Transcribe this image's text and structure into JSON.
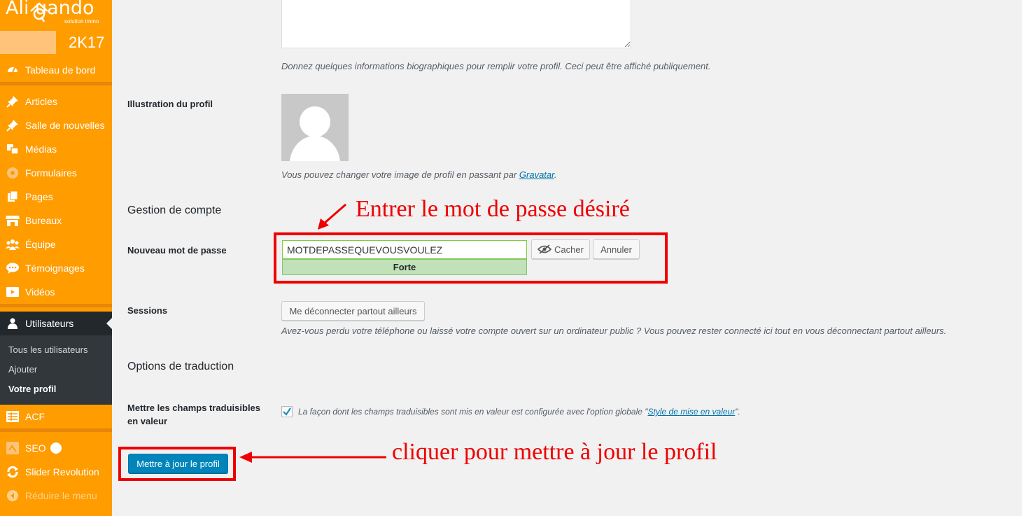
{
  "sidebar": {
    "logo": {
      "brand": "Ali  uando",
      "tagline": "solution immo"
    },
    "year_badge": "2K17",
    "menu": [
      {
        "label": "Tableau de bord",
        "icon": "dashboard-icon"
      },
      {
        "label": "Articles",
        "icon": "pin-icon"
      },
      {
        "label": "Salle de nouvelles",
        "icon": "pin-icon"
      },
      {
        "label": "Médias",
        "icon": "media-icon"
      },
      {
        "label": "Formulaires",
        "icon": "forms-icon"
      },
      {
        "label": "Pages",
        "icon": "pages-icon"
      },
      {
        "label": "Bureaux",
        "icon": "store-icon"
      },
      {
        "label": "Équipe",
        "icon": "groups-icon"
      },
      {
        "label": "Témoignages",
        "icon": "testimonial-icon"
      },
      {
        "label": "Vidéos",
        "icon": "video-icon"
      },
      {
        "label": "Utilisateurs",
        "icon": "users-icon"
      },
      {
        "label": "ACF",
        "icon": "acf-icon"
      },
      {
        "label": "SEO",
        "icon": "seo-icon"
      },
      {
        "label": "Slider Revolution",
        "icon": "refresh-icon"
      },
      {
        "label": "Réduire le menu",
        "icon": "collapse-icon"
      }
    ],
    "submenu": [
      {
        "label": "Tous les utilisateurs"
      },
      {
        "label": "Ajouter"
      },
      {
        "label": "Votre profil"
      }
    ]
  },
  "profile": {
    "bio_description": "Donnez quelques informations biographiques pour remplir votre profil. Ceci peut être affiché publiquement.",
    "picture_label": "Illustration du profil",
    "picture_desc_prefix": "Vous pouvez changer votre image de profil en passant par ",
    "picture_desc_link": "Gravatar",
    "picture_desc_suffix": ".",
    "account_heading": "Gestion de compte",
    "new_password_label": "Nouveau mot de passe",
    "new_password_value": "MOTDEPASSEQUEVOUSVOULEZ",
    "strength": "Forte",
    "hide_button": "Cacher",
    "cancel_button": "Annuler",
    "sessions_label": "Sessions",
    "sessions_button": "Me déconnecter partout ailleurs",
    "sessions_desc": "Avez-vous perdu votre téléphone ou laissé votre compte ouvert sur un ordinateur public ? Vous pouvez rester connecté ici tout en vous déconnectant partout ailleurs.",
    "translation_heading": "Options de traduction",
    "translatable_label_line1": "Mettre les champs traduisibles",
    "translatable_label_line2": "en valeur",
    "translatable_desc_prefix": "La façon dont les champs traduisibles sont mis en valeur est configurée avec l'option globale \"",
    "translatable_desc_link": "Style de mise en valeur",
    "translatable_desc_suffix": "\".",
    "translatable_checked": true,
    "submit_button": "Mettre à jour le profil"
  },
  "annotations": {
    "password_note": "Entrer le mot de passe désiré",
    "submit_note": "cliquer pour mettre à jour le profil",
    "color": "#e00000"
  }
}
